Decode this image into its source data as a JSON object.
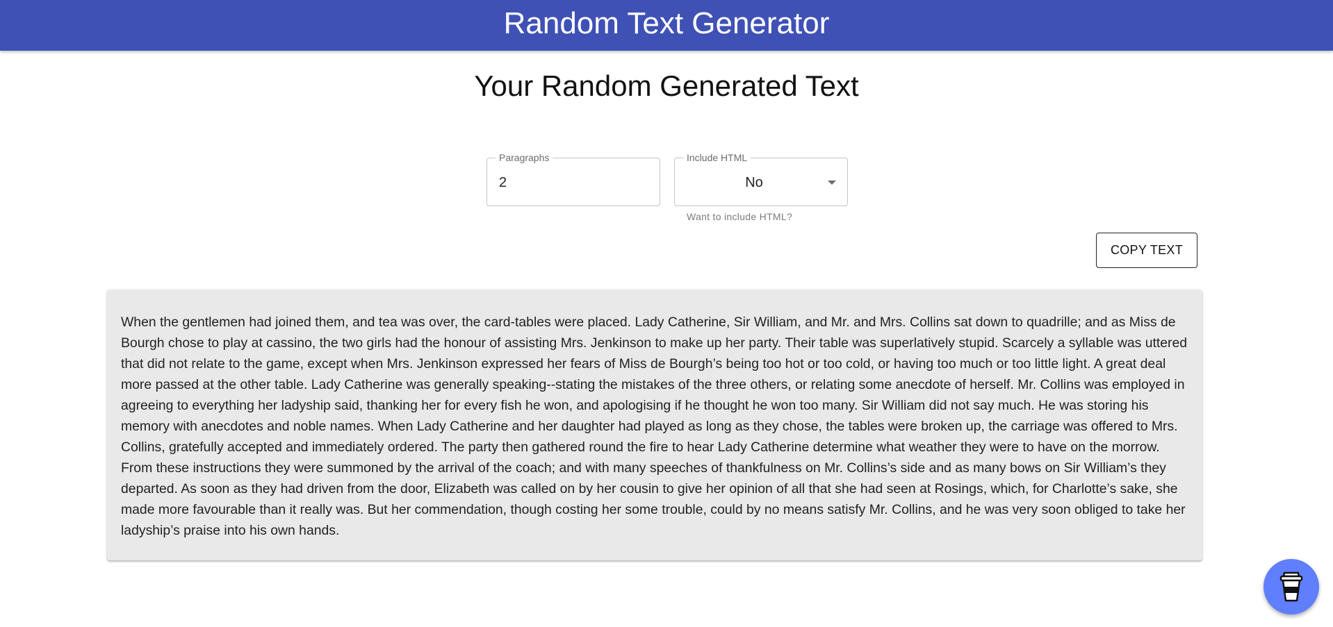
{
  "header": {
    "title": "Random Text Generator"
  },
  "main": {
    "heading": "Your Random Generated Text",
    "paragraphs_field": {
      "label": "Paragraphs",
      "value": "2"
    },
    "include_html_field": {
      "label": "Include HTML",
      "value": "No",
      "helper": "Want to include HTML?"
    },
    "copy_button_label": "COPY TEXT",
    "generated_text": "When the gentlemen had joined them, and tea was over, the card-tables were placed. Lady Catherine, Sir William, and Mr. and Mrs. Collins sat down to quadrille; and as Miss de Bourgh chose to play at cassino, the two girls had the honour of assisting Mrs. Jenkinson to make up her party. Their table was superlatively stupid. Scarcely a syllable was uttered that did not relate to the game, except when Mrs. Jenkinson expressed her fears of Miss de Bourgh’s being too hot or too cold, or having too much or too little light. A great deal more passed at the other table. Lady Catherine was generally speaking--stating the mistakes of the three others, or relating some anecdote of herself. Mr. Collins was employed in agreeing to everything her ladyship said, thanking her for every fish he won, and apologising if he thought he won too many. Sir William did not say much. He was storing his memory with anecdotes and noble names. When Lady Catherine and her daughter had played as long as they chose, the tables were broken up, the carriage was offered to Mrs. Collins, gratefully accepted and immediately ordered. The party then gathered round the fire to hear Lady Catherine determine what weather they were to have on the morrow. From these instructions they were summoned by the arrival of the coach; and with many speeches of thankfulness on Mr. Collins’s side and as many bows on Sir William’s they departed. As soon as they had driven from the door, Elizabeth was called on by her cousin to give her opinion of all that she had seen at Rosings, which, for Charlotte’s sake, she made more favourable than it really was. But her commendation, though costing her some trouble, could by no means satisfy Mr. Collins, and he was very soon obliged to take her ladyship’s praise into his own hands."
  },
  "fab": {
    "icon": "coffee-cup-icon"
  },
  "colors": {
    "app_bar": "#3f51b5",
    "text_paper": "#e9e9e9",
    "fab": "#5f7fff"
  }
}
